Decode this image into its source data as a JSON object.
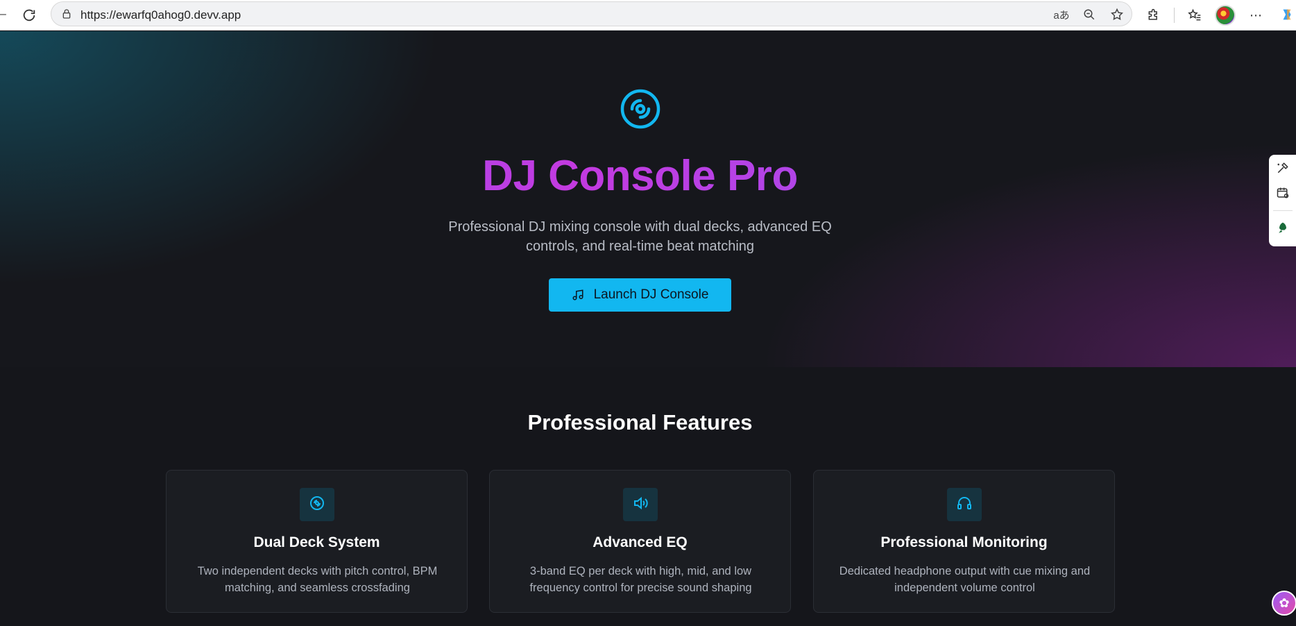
{
  "browser": {
    "url": "https://ewarfq0ahog0.devv.app",
    "read_aloud_icon": "aあ"
  },
  "hero": {
    "title": "DJ Console Pro",
    "subtitle": "Professional DJ mixing console with dual decks, advanced EQ controls, and real-time beat matching",
    "cta_label": "Launch DJ Console",
    "icon": "disc-icon"
  },
  "features": {
    "heading": "Professional Features",
    "cards": [
      {
        "icon": "disc-icon",
        "title": "Dual Deck System",
        "description": "Two independent decks with pitch control, BPM matching, and seamless crossfading"
      },
      {
        "icon": "volume-icon",
        "title": "Advanced EQ",
        "description": "3-band EQ per deck with high, mid, and low frequency control for precise sound shaping"
      },
      {
        "icon": "headphones-icon",
        "title": "Professional Monitoring",
        "description": "Dedicated headphone output with cue mixing and independent volume control"
      }
    ]
  },
  "colors": {
    "accent": "#12b7f0",
    "title_gradient_start": "#8a5cf6",
    "title_gradient_mid": "#c33ae0",
    "background": "#15161b",
    "card_background": "#1b1d22"
  }
}
